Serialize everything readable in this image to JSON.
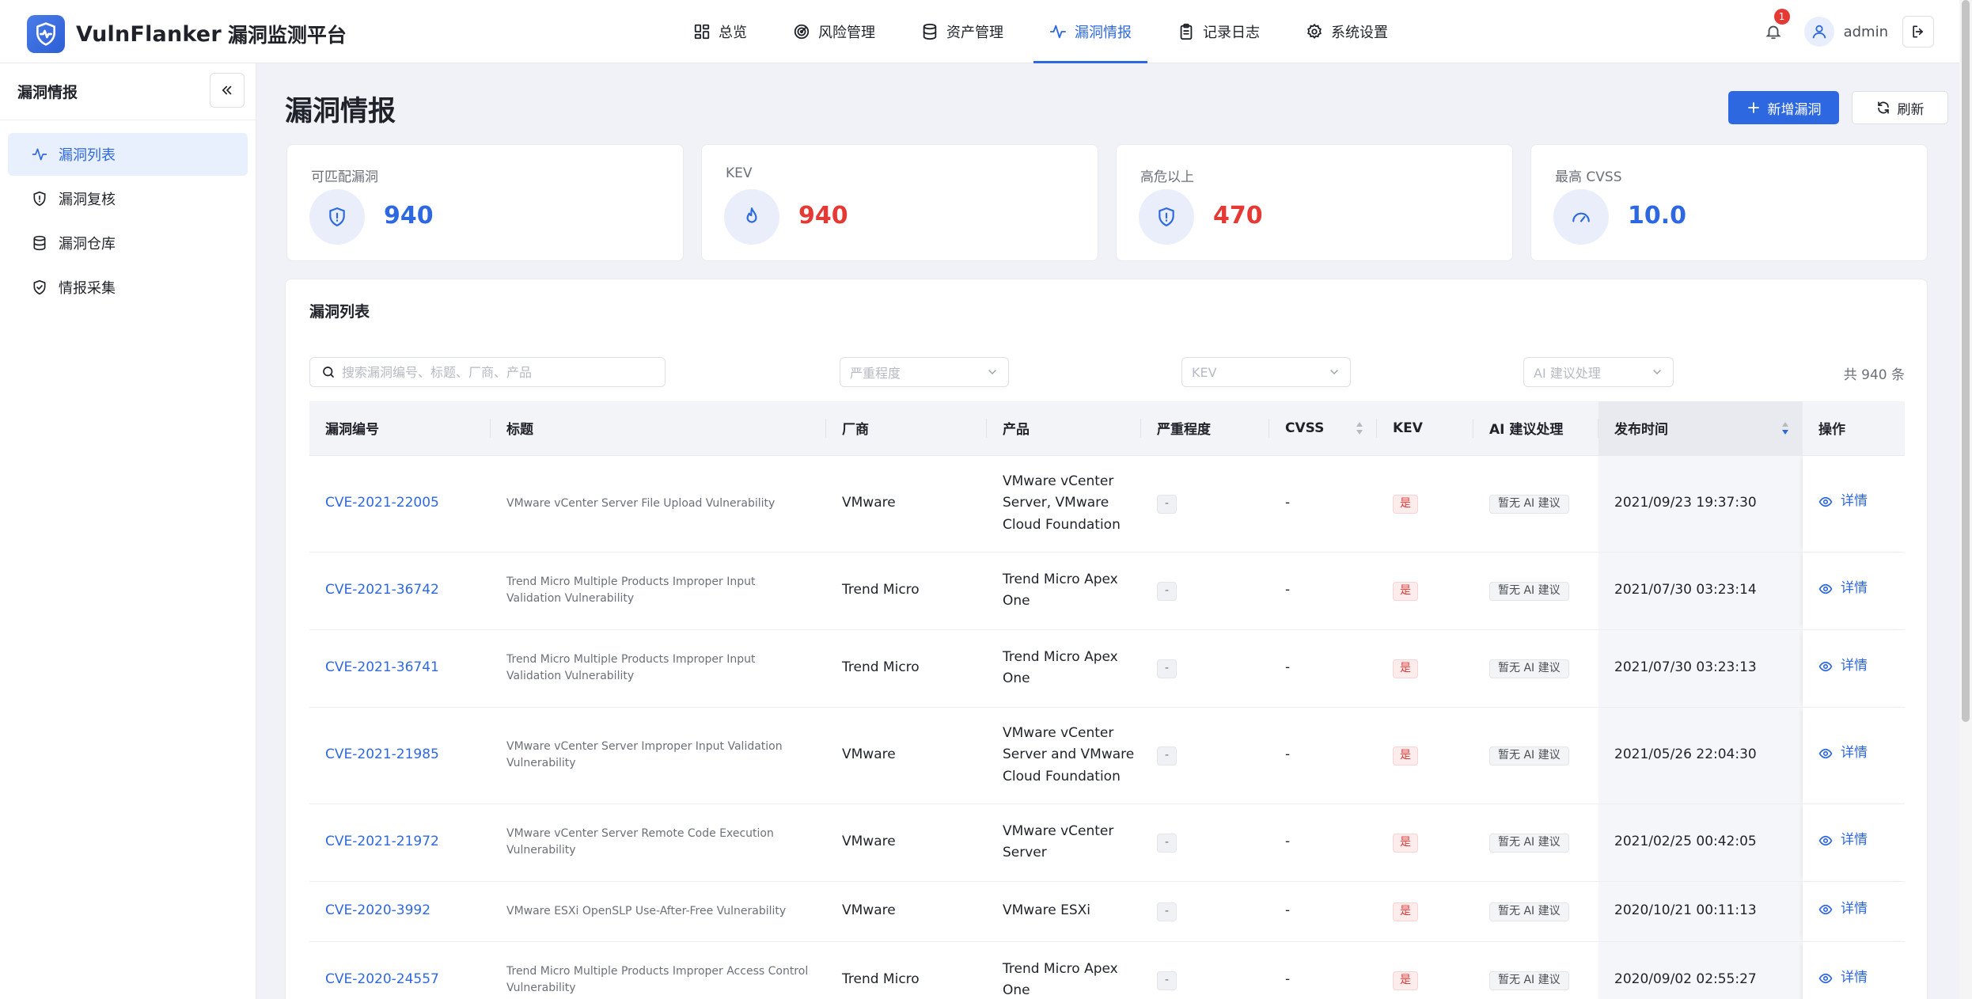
{
  "brand": {
    "name": "VulnFlanker",
    "subtitle": "漏洞监测平台"
  },
  "nav": [
    {
      "label": "总览",
      "icon": "dashboard-icon"
    },
    {
      "label": "风险管理",
      "icon": "radar-icon"
    },
    {
      "label": "资产管理",
      "icon": "database-icon"
    },
    {
      "label": "漏洞情报",
      "icon": "activity-icon",
      "active": true
    },
    {
      "label": "记录日志",
      "icon": "clipboard-icon"
    },
    {
      "label": "系统设置",
      "icon": "gear-icon"
    }
  ],
  "user": {
    "name": "admin",
    "notifications": "1"
  },
  "sidebar": {
    "title": "漏洞情报",
    "items": [
      {
        "label": "漏洞列表",
        "icon": "activity-icon",
        "active": true
      },
      {
        "label": "漏洞复核",
        "icon": "shield-alert-icon"
      },
      {
        "label": "漏洞仓库",
        "icon": "database-icon"
      },
      {
        "label": "情报采集",
        "icon": "shield-check-icon"
      }
    ]
  },
  "page": {
    "title": "漏洞情报",
    "add_button": "新增漏洞",
    "refresh_button": "刷新"
  },
  "stats": [
    {
      "label": "可匹配漏洞",
      "value": "940",
      "color": "#2e68e0",
      "icon": "shield-alert-icon"
    },
    {
      "label": "KEV",
      "value": "940",
      "color": "#e53935",
      "icon": "flame-icon"
    },
    {
      "label": "高危以上",
      "value": "470",
      "color": "#e53935",
      "icon": "shield-alert-icon"
    },
    {
      "label": "最高 CVSS",
      "value": "10.0",
      "color": "#2e68e0",
      "icon": "gauge-icon"
    }
  ],
  "list": {
    "title": "漏洞列表",
    "search_placeholder": "搜索漏洞编号、标题、厂商、产品",
    "filters": {
      "severity": "严重程度",
      "kev": "KEV",
      "ai": "AI 建议处理"
    },
    "total": "共 940 条",
    "columns": [
      "漏洞编号",
      "标题",
      "厂商",
      "产品",
      "严重程度",
      "CVSS",
      "KEV",
      "AI 建议处理",
      "发布时间",
      "操作"
    ],
    "rows": [
      {
        "id": "CVE-2021-22005",
        "title": "VMware vCenter Server File Upload Vulnerability",
        "vendor": "VMware",
        "product": "VMware vCenter Server, VMware Cloud Foundation",
        "severity": "-",
        "cvss": "-",
        "kev": "是",
        "ai": "暂无 AI 建议",
        "date": "2021/09/23 19:37:30",
        "action": "详情"
      },
      {
        "id": "CVE-2021-36742",
        "title": "Trend Micro Multiple Products Improper Input Validation Vulnerability",
        "vendor": "Trend Micro",
        "product": "Trend Micro Apex One",
        "severity": "-",
        "cvss": "-",
        "kev": "是",
        "ai": "暂无 AI 建议",
        "date": "2021/07/30 03:23:14",
        "action": "详情"
      },
      {
        "id": "CVE-2021-36741",
        "title": "Trend Micro Multiple Products Improper Input Validation Vulnerability",
        "vendor": "Trend Micro",
        "product": "Trend Micro Apex One",
        "severity": "-",
        "cvss": "-",
        "kev": "是",
        "ai": "暂无 AI 建议",
        "date": "2021/07/30 03:23:13",
        "action": "详情"
      },
      {
        "id": "CVE-2021-21985",
        "title": "VMware vCenter Server Improper Input Validation Vulnerability",
        "vendor": "VMware",
        "product": "VMware vCenter Server and VMware Cloud Foundation",
        "severity": "-",
        "cvss": "-",
        "kev": "是",
        "ai": "暂无 AI 建议",
        "date": "2021/05/26 22:04:30",
        "action": "详情"
      },
      {
        "id": "CVE-2021-21972",
        "title": "VMware vCenter Server Remote Code Execution Vulnerability",
        "vendor": "VMware",
        "product": "VMware vCenter Server",
        "severity": "-",
        "cvss": "-",
        "kev": "是",
        "ai": "暂无 AI 建议",
        "date": "2021/02/25 00:42:05",
        "action": "详情"
      },
      {
        "id": "CVE-2020-3992",
        "title": "VMware ESXi OpenSLP Use-After-Free Vulnerability",
        "vendor": "VMware",
        "product": "VMware ESXi",
        "severity": "-",
        "cvss": "-",
        "kev": "是",
        "ai": "暂无 AI 建议",
        "date": "2020/10/21 00:11:13",
        "action": "详情"
      },
      {
        "id": "CVE-2020-24557",
        "title": "Trend Micro Multiple Products Improper Access Control Vulnerability",
        "vendor": "Trend Micro",
        "product": "Trend Micro Apex One",
        "severity": "-",
        "cvss": "-",
        "kev": "是",
        "ai": "暂无 AI 建议",
        "date": "2020/09/02 02:55:27",
        "action": "详情"
      }
    ]
  }
}
